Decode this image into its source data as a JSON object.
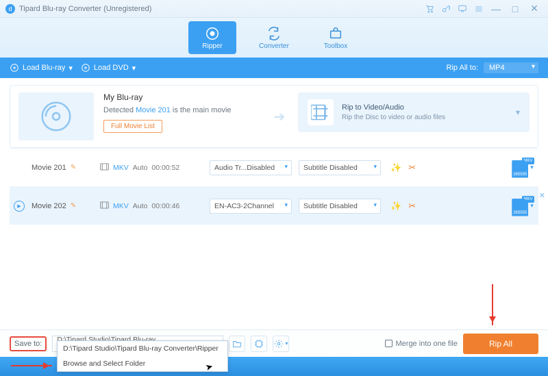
{
  "title": "Tipard Blu-ray Converter (Unregistered)",
  "tabs": {
    "ripper": "Ripper",
    "converter": "Converter",
    "toolbox": "Toolbox"
  },
  "toolbar": {
    "load_bluray": "Load Blu-ray",
    "load_dvd": "Load DVD",
    "rip_all_to_label": "Rip All to:",
    "rip_all_format": "MP4"
  },
  "disc": {
    "title": "My Blu-ray",
    "detected_pre": "Detected ",
    "detected_link": "Movie 201",
    "detected_post": " is the main movie",
    "full_list_btn": "Full Movie List"
  },
  "rip_card": {
    "title": "Rip to Video/Audio",
    "subtitle": "Rip the Disc to video or audio files"
  },
  "rows": [
    {
      "name": "Movie 201",
      "container": "MKV",
      "auto": "Auto",
      "duration": "00:00:52",
      "audio": "Audio Tr...Disabled",
      "subtitle": "Subtitle Disabled",
      "fmt_tag": "MKV",
      "fmt_label": "265555"
    },
    {
      "name": "Movie 202",
      "container": "MKV",
      "auto": "Auto",
      "duration": "00:00:46",
      "audio": "EN-AC3-2Channel",
      "subtitle": "Subtitle Disabled",
      "fmt_tag": "MKV",
      "fmt_label": "265555"
    }
  ],
  "bottom": {
    "save_to_label": "Save to:",
    "path": "D:\\Tipard Studio\\Tipard Blu-ray Converter\\Ripper",
    "merge_label": "Merge into one file",
    "rip_all_btn": "Rip All",
    "dropdown": {
      "recent": "D:\\Tipard Studio\\Tipard Blu-ray Converter\\Ripper",
      "browse": "Browse and Select Folder"
    }
  }
}
